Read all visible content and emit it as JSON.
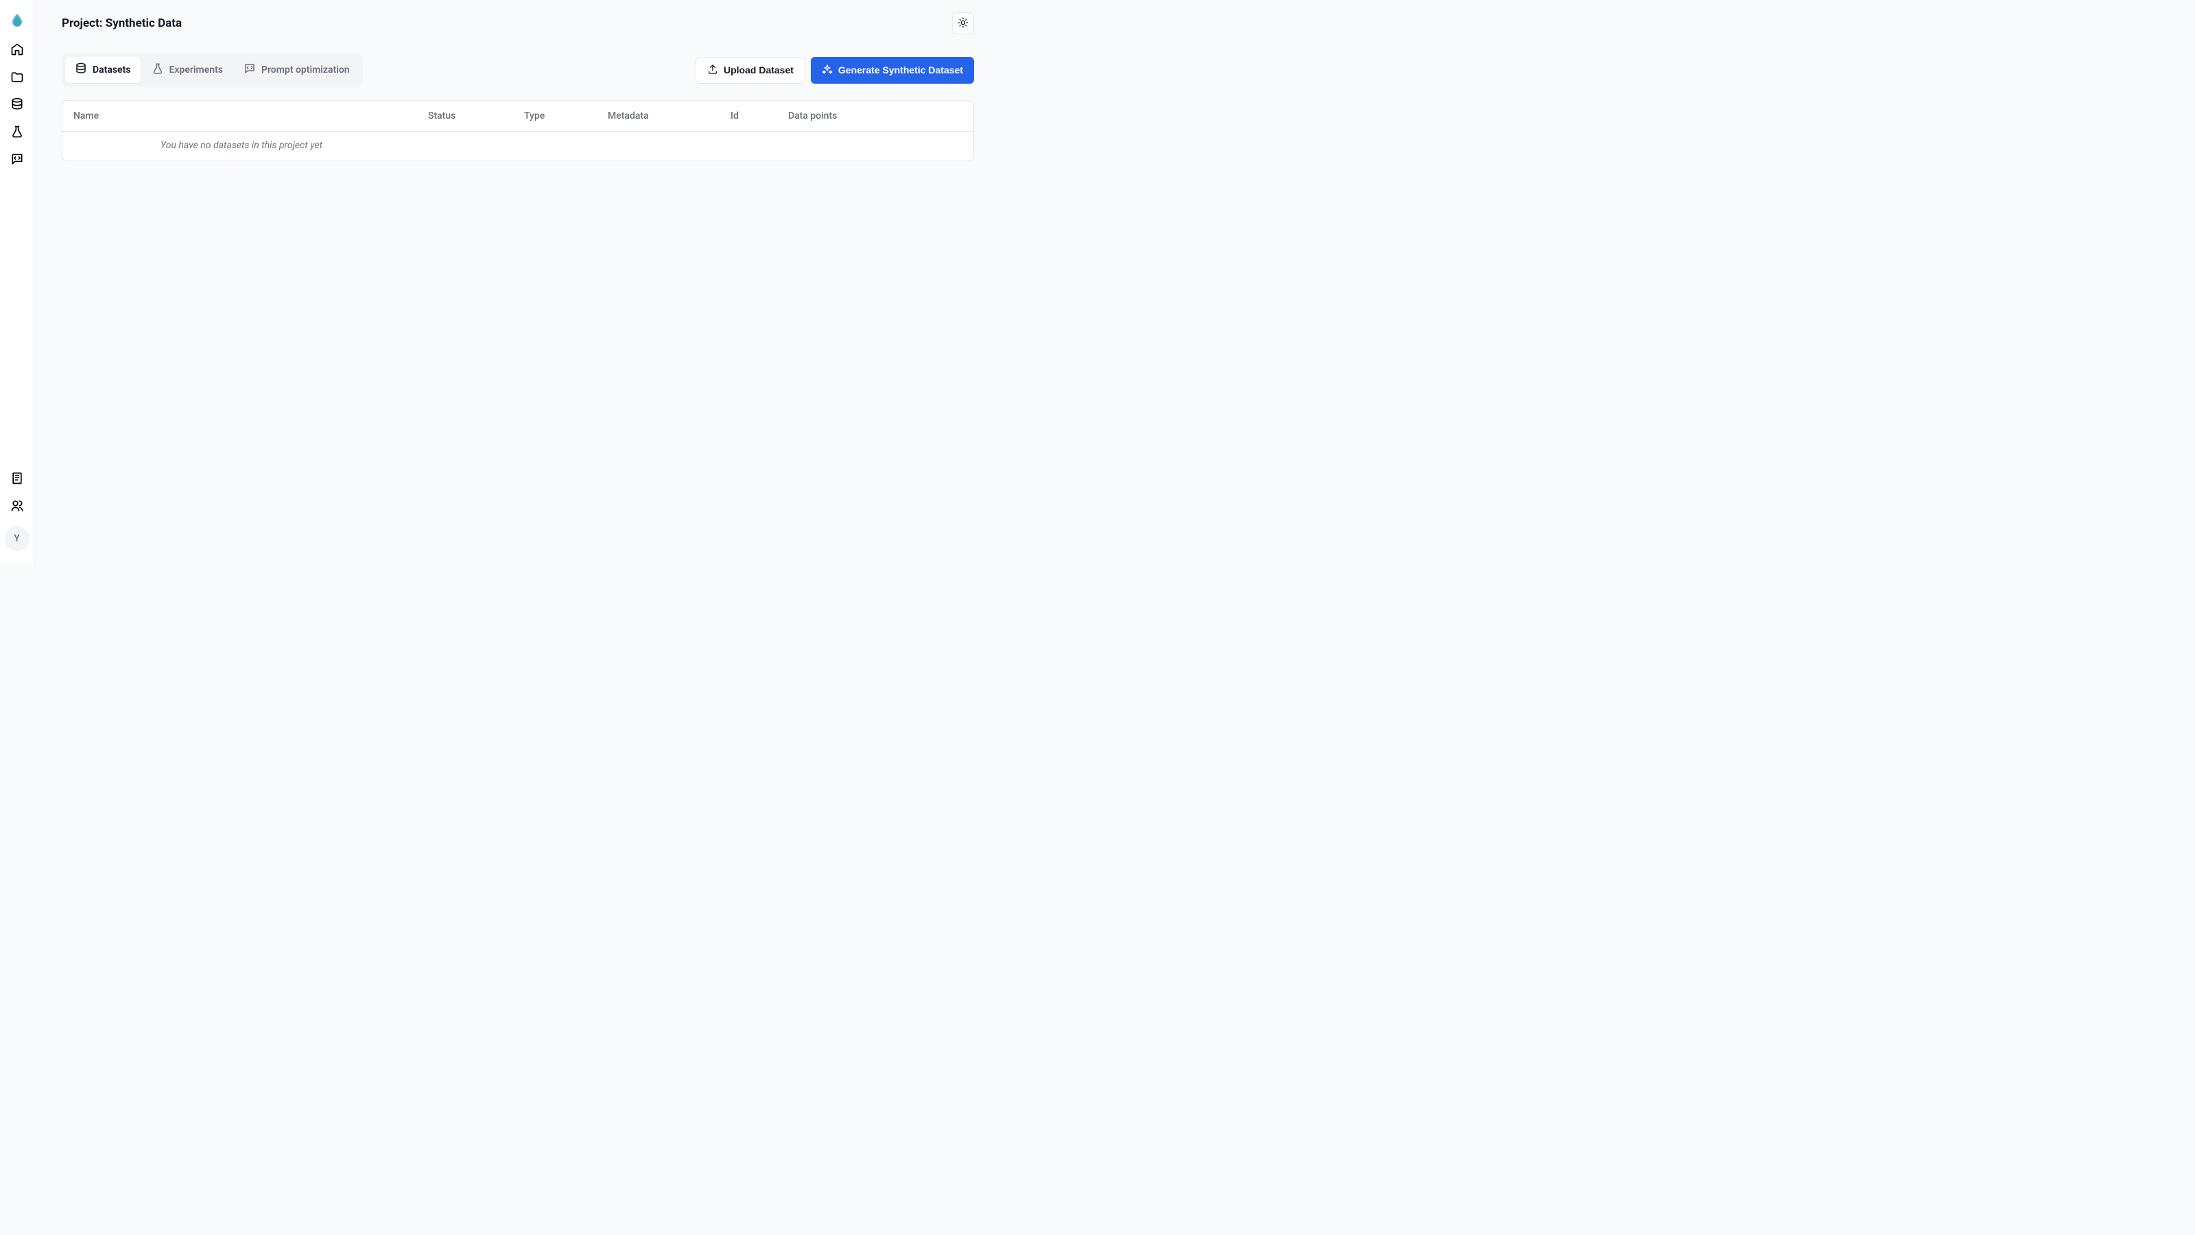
{
  "header": {
    "title": "Project: Synthetic Data"
  },
  "tabs": [
    {
      "label": "Datasets",
      "active": true
    },
    {
      "label": "Experiments",
      "active": false
    },
    {
      "label": "Prompt optimization",
      "active": false
    }
  ],
  "actions": {
    "upload_label": "Upload Dataset",
    "generate_label": "Generate Synthetic Dataset"
  },
  "table": {
    "columns": [
      "Name",
      "Status",
      "Type",
      "Metadata",
      "Id",
      "Data points"
    ],
    "empty_message": "You have no datasets in this project yet"
  },
  "avatar": {
    "initial": "Y"
  }
}
